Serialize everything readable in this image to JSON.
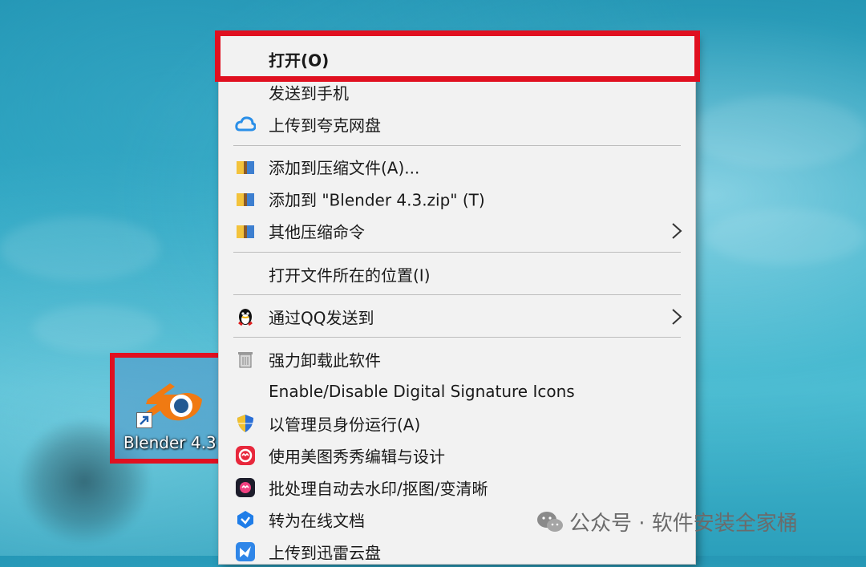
{
  "desktop": {
    "shortcut_label": "Blender 4.3"
  },
  "context_menu": {
    "items": [
      {
        "label": "打开(O)",
        "icon": "none"
      },
      {
        "label": "发送到手机",
        "icon": "none"
      },
      {
        "label": "上传到夸克网盘",
        "icon": "quark-cloud-icon"
      },
      {
        "label": "添加到压缩文件(A)...",
        "icon": "archive-icon"
      },
      {
        "label": "添加到 \"Blender 4.3.zip\" (T)",
        "icon": "archive-icon"
      },
      {
        "label": "其他压缩命令",
        "icon": "archive-icon",
        "submenu": true
      },
      {
        "label": "打开文件所在的位置(I)",
        "icon": "none"
      },
      {
        "label": "通过QQ发送到",
        "icon": "qq-penguin-icon",
        "submenu": true
      },
      {
        "label": "强力卸载此软件",
        "icon": "trash-icon"
      },
      {
        "label": "Enable/Disable Digital Signature Icons",
        "icon": "none"
      },
      {
        "label": "以管理员身份运行(A)",
        "icon": "uac-shield-icon"
      },
      {
        "label": "使用美图秀秀编辑与设计",
        "icon": "meitu-icon"
      },
      {
        "label": "批处理自动去水印/抠图/变清晰",
        "icon": "batch-process-icon"
      },
      {
        "label": "转为在线文档",
        "icon": "online-doc-icon"
      },
      {
        "label": "上传到迅雷云盘",
        "icon": "xunlei-icon"
      }
    ]
  },
  "watermark": {
    "text": "公众号 · 软件安装全家桶",
    "icon": "wechat-icon"
  },
  "colors": {
    "highlight_red": "#e01020",
    "menu_bg": "#f2f2f2"
  }
}
